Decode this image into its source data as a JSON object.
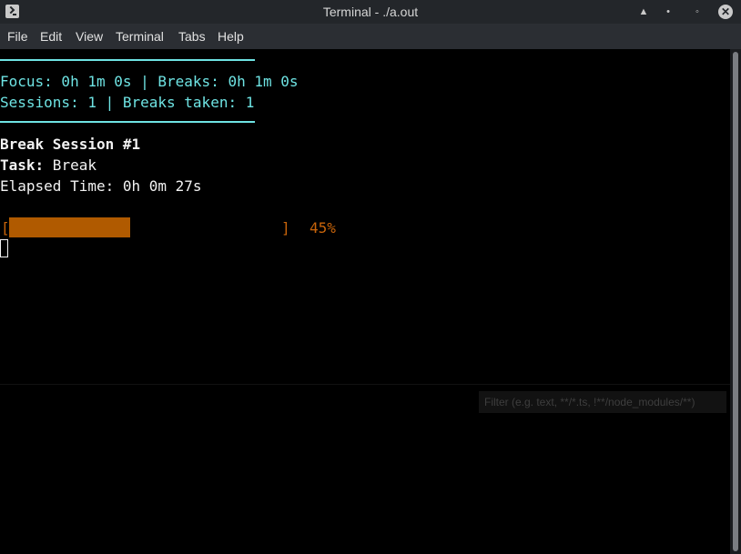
{
  "window": {
    "title": "Terminal - ./a.out",
    "icon": "terminal-icon",
    "buttons": {
      "shade": "▲",
      "minimize": "•",
      "maximize": "◦",
      "close": "✕"
    }
  },
  "menu": [
    "File",
    "Edit",
    "View",
    "Terminal",
    "Tabs",
    "Help"
  ],
  "terminal": {
    "focus_line": "Focus: 0h 1m 0s | Breaks: 0h 1m 0s",
    "sessions_line": "Sessions: 1 | Breaks taken: 1",
    "session_title": "Break Session #1",
    "task_label": "Task:",
    "task_value": " Break",
    "elapsed_line": "Elapsed Time: 0h 0m 27s",
    "progress": {
      "open_bracket": "[",
      "close_bracket": "]",
      "percent_text": "45%",
      "fraction": 0.45
    }
  },
  "filter": {
    "placeholder": "Filter (e.g. text, **/*.ts, !**/node_modules/**)"
  },
  "colors": {
    "accent_cyan": "#6ee3e3",
    "progress_orange": "#b05a00",
    "percent_orange": "#c8640a"
  }
}
